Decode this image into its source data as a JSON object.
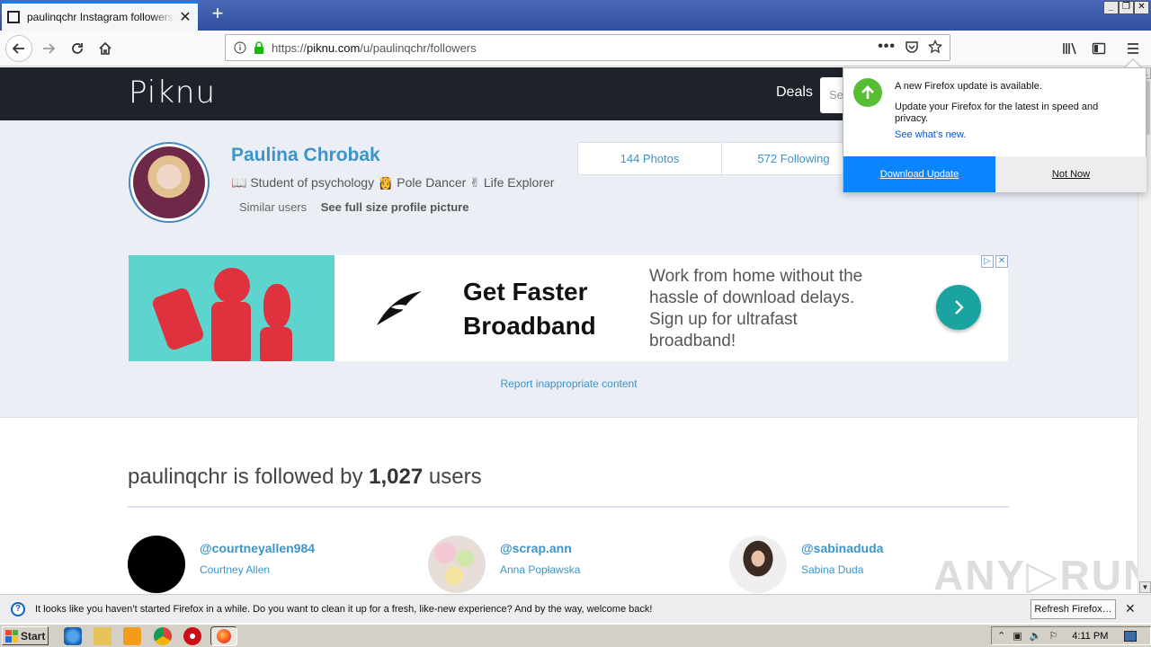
{
  "browser": {
    "tab_title": "paulinqchr Instagram followers - Piknu",
    "url_prefix": "https://",
    "url_domain": "piknu.com",
    "url_path": "/u/paulinqchr/followers"
  },
  "site": {
    "logo": "Piknu",
    "nav_deals": "Deals",
    "search_placeholder": "Se"
  },
  "profile": {
    "name": "Paulina Chrobak",
    "bio": "📖 Student of psychology 👸 Pole Dancer ✌ Life Explorer",
    "similar_users": "Similar users",
    "full_size_link": "See full size profile picture",
    "stats": [
      {
        "label": "144 Photos"
      },
      {
        "label": "572 Following"
      }
    ]
  },
  "ad": {
    "title": "Get Faster Broadband",
    "description": "Work from home without the hassle of download delays. Sign up for ultrafast broadband!"
  },
  "report_link": "Report inappropriate content",
  "followers": {
    "heading_prefix": "paulinqchr is followed by ",
    "count": "1,027",
    "heading_suffix": " users",
    "users": [
      {
        "handle": "@courtneyallen984",
        "name": "Courtney Allen"
      },
      {
        "handle": "@scrap.ann",
        "name": "Anna Popławska"
      },
      {
        "handle": "@sabinaduda",
        "name": "Sabina Duda"
      }
    ]
  },
  "update_panel": {
    "title": "A new Firefox update is available.",
    "body": "Update your Firefox for the latest in speed and privacy.",
    "link": "See what’s new.",
    "primary_button": "Download Update",
    "secondary_button": "Not Now",
    "icon_color": "#57bd35"
  },
  "notification": {
    "text": "It looks like you haven’t started Firefox in a while. Do you want to clean it up for a fresh, like-new experience? And by the way, welcome back!",
    "button": "Refresh Firefox…"
  },
  "taskbar": {
    "start_label": "Start",
    "clock": "4:11 PM"
  },
  "watermark": "ANY▷RUN",
  "colors": {
    "accent": "#3c94c8",
    "header_bg": "#1e232b",
    "firefox_blue": "#0a84ff"
  }
}
